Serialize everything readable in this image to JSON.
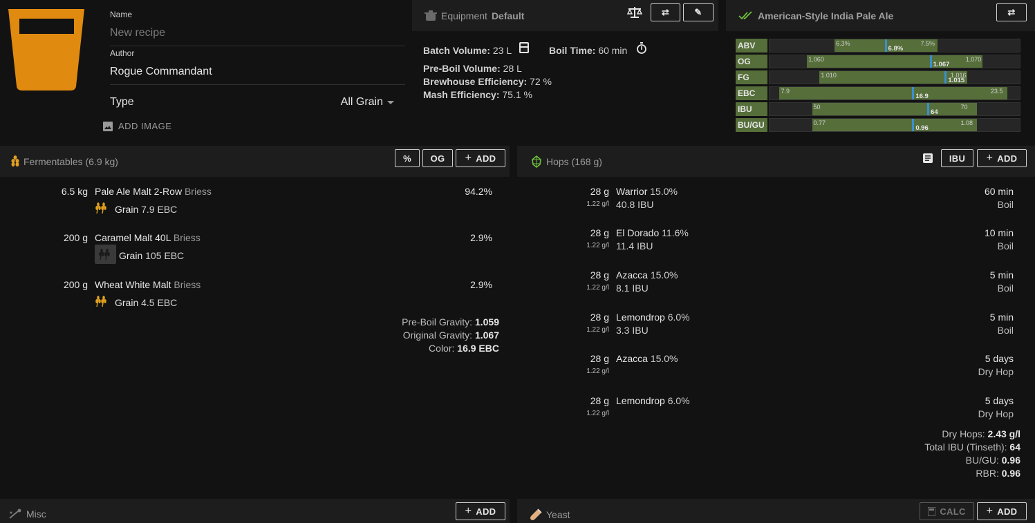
{
  "recipe": {
    "name_label": "Name",
    "name_placeholder": "New recipe",
    "author_label": "Author",
    "author_value": "Rogue Commandant",
    "type_label": "Type",
    "type_value": "All Grain",
    "add_image_label": "ADD IMAGE",
    "beer_color": "#e08a0f"
  },
  "equipment": {
    "title_prefix": "Equipment",
    "title_value": "Default",
    "batch_volume_label": "Batch Volume:",
    "batch_volume_value": "23 L",
    "boil_time_label": "Boil Time:",
    "boil_time_value": "60 min",
    "pre_boil_label": "Pre-Boil Volume:",
    "pre_boil_value": "28 L",
    "brewhouse_label": "Brewhouse Efficiency:",
    "brewhouse_value": "72 %",
    "mash_label": "Mash Efficiency:",
    "mash_value": "75.1 %"
  },
  "style": {
    "title": "American-Style India Pale Ale",
    "check_color": "#6fbf3a",
    "rows": [
      {
        "label": "ABV",
        "lo": "6.3%",
        "hi": "7.5%",
        "value": "6.8%",
        "range": [
          0.26,
          0.67
        ],
        "pos": 0.46
      },
      {
        "label": "OG",
        "lo": "1.060",
        "hi": "1.070",
        "value": "1.067",
        "range": [
          0.15,
          0.85
        ],
        "pos": 0.64
      },
      {
        "label": "FG",
        "lo": "1.010",
        "hi": "1.016",
        "value": "1.015",
        "range": [
          0.2,
          0.79
        ],
        "pos": 0.7
      },
      {
        "label": "EBC",
        "lo": "7.9",
        "hi": "23.5",
        "value": "16.9",
        "range": [
          0.04,
          0.95
        ],
        "pos": 0.57
      },
      {
        "label": "IBU",
        "lo": "50",
        "hi": "70",
        "value": "64",
        "range": [
          0.17,
          0.83
        ],
        "pos": 0.63
      },
      {
        "label": "BU/GU",
        "lo": "0.77",
        "hi": "1.08",
        "value": "0.96",
        "range": [
          0.17,
          0.83
        ],
        "pos": 0.57
      }
    ]
  },
  "fermentables": {
    "title": "Fermentables (6.9 kg)",
    "percent_btn": "%",
    "og_btn": "OG",
    "add_btn": "ADD",
    "items": [
      {
        "amount": "6.5 kg",
        "name": "Pale Ale Malt 2-Row",
        "supplier": "Briess",
        "percent": "94.2%",
        "type": "Grain",
        "color": "7.9 EBC",
        "icon_color": "#e0a020",
        "dark": false
      },
      {
        "amount": "200 g",
        "name": "Caramel Malt 40L",
        "supplier": "Briess",
        "percent": "2.9%",
        "type": "Grain",
        "color": "105 EBC",
        "icon_color": "#1a1a1a",
        "dark": true
      },
      {
        "amount": "200 g",
        "name": "Wheat White Malt",
        "supplier": "Briess",
        "percent": "2.9%",
        "type": "Grain",
        "color": "4.5 EBC",
        "icon_color": "#e0a020",
        "dark": false
      }
    ],
    "summary": [
      {
        "label": "Pre-Boil Gravity:",
        "value": "1.059"
      },
      {
        "label": "Original Gravity:",
        "value": "1.067"
      },
      {
        "label": "Color:",
        "value": "16.9 EBC"
      }
    ]
  },
  "hops": {
    "title": "Hops (168 g)",
    "ibu_btn": "IBU",
    "add_btn": "ADD",
    "items": [
      {
        "amount": "28 g",
        "density": "1.22 g/l",
        "name": "Warrior",
        "alpha": "15.0%",
        "ibu": "40.8 IBU",
        "time": "60 min",
        "use": "Boil"
      },
      {
        "amount": "28 g",
        "density": "1.22 g/l",
        "name": "El Dorado",
        "alpha": "11.6%",
        "ibu": "11.4 IBU",
        "time": "10 min",
        "use": "Boil"
      },
      {
        "amount": "28 g",
        "density": "1.22 g/l",
        "name": "Azacca",
        "alpha": "15.0%",
        "ibu": "8.1 IBU",
        "time": "5 min",
        "use": "Boil"
      },
      {
        "amount": "28 g",
        "density": "1.22 g/l",
        "name": "Lemondrop",
        "alpha": "6.0%",
        "ibu": "3.3 IBU",
        "time": "5 min",
        "use": "Boil"
      },
      {
        "amount": "28 g",
        "density": "1.22 g/l",
        "name": "Azacca",
        "alpha": "15.0%",
        "ibu": "",
        "time": "5 days",
        "use": "Dry Hop"
      },
      {
        "amount": "28 g",
        "density": "1.22 g/l",
        "name": "Lemondrop",
        "alpha": "6.0%",
        "ibu": "",
        "time": "5 days",
        "use": "Dry Hop"
      }
    ],
    "summary": [
      {
        "label": "Dry Hops:",
        "value": "2.43 g/l"
      },
      {
        "label": "Total IBU (Tinseth):",
        "value": "64"
      },
      {
        "label": "BU/GU:",
        "value": "0.96"
      },
      {
        "label": "RBR:",
        "value": "0.96"
      }
    ]
  },
  "misc": {
    "title": "Misc",
    "add_btn": "ADD"
  },
  "yeast": {
    "title": "Yeast",
    "calc_btn": "CALC",
    "add_btn": "ADD"
  }
}
